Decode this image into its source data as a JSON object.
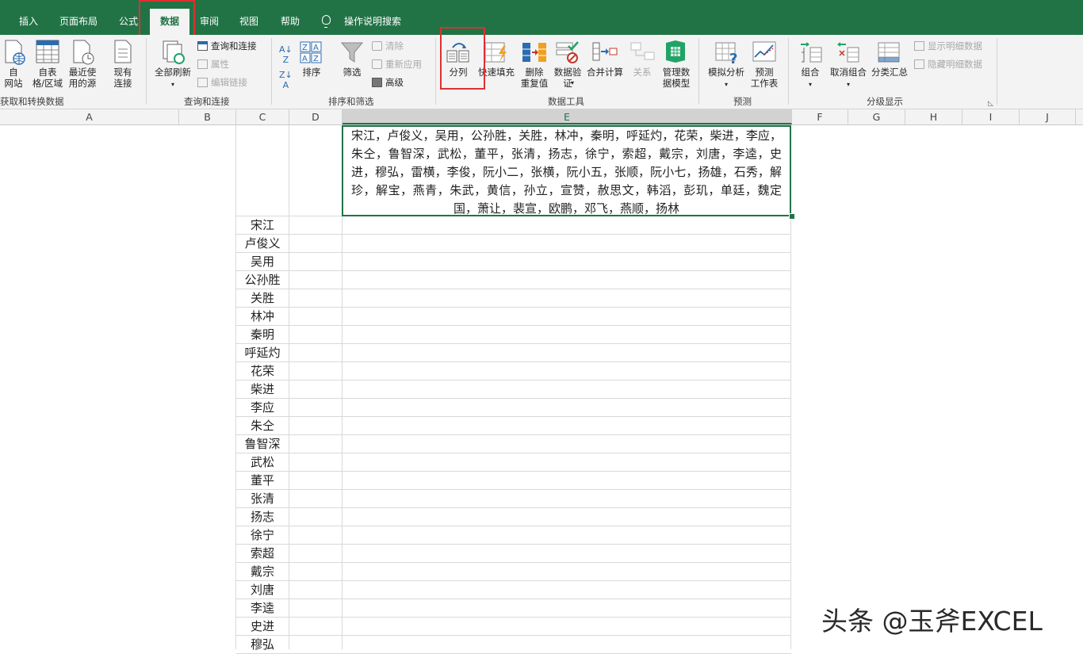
{
  "tabs": [
    "插入",
    "页面布局",
    "公式",
    "数据",
    "审阅",
    "视图",
    "帮助",
    "操作说明搜索"
  ],
  "ribbon": {
    "get_transform": {
      "from_web": "自\n网站",
      "from_table": "自表\n格/区域",
      "recent_sources": "最近使\n用的源",
      "existing": "现有\n连接",
      "group_label": "获取和转换数据"
    },
    "queries": {
      "refresh_all": "全部刷新",
      "queries_connections": "查询和连接",
      "properties": "属性",
      "edit_links": "编辑链接",
      "group_label": "查询和连接"
    },
    "sort_filter": {
      "sort": "排序",
      "filter": "筛选",
      "clear": "清除",
      "reapply": "重新应用",
      "advanced": "高级",
      "group_label": "排序和筛选"
    },
    "data_tools": {
      "text_to_columns": "分列",
      "flash_fill": "快速填充",
      "remove_dup": "删除\n重复值",
      "validation": "数据验\n证",
      "consolidate": "合并计算",
      "relationships": "关系",
      "data_model": "管理数\n据模型",
      "group_label": "数据工具"
    },
    "forecast": {
      "what_if": "模拟分析",
      "forecast_sheet": "预测\n工作表",
      "group_label": "预测"
    },
    "outline": {
      "group": "组合",
      "ungroup": "取消组合",
      "subtotal": "分类汇总",
      "show_detail": "显示明细数据",
      "hide_detail": "隐藏明细数据",
      "group_label": "分级显示"
    }
  },
  "columns": [
    "A",
    "B",
    "C",
    "D",
    "E",
    "F",
    "G",
    "H",
    "I",
    "J"
  ],
  "cell_E1": "宋江，卢俊义，吴用，公孙胜，关胜，林冲，秦明，呼延灼，花荣，柴进，李应，朱仝，鲁智深，武松，董平，张清，扬志，徐宁，索超，戴宗，刘唐，李逵，史进，穆弘，雷横，李俊，阮小二，张横，阮小五，张顺，阮小七，扬雄，石秀，解珍，解宝，燕青，朱武，黄信，孙立，宣赞，赦思文，韩滔，彭玑，单廷，魏定国，萧让，裴宣，欧鹏，邓飞，燕顺，扬林",
  "column_C": [
    "宋江",
    "卢俊义",
    "吴用",
    "公孙胜",
    "关胜",
    "林冲",
    "秦明",
    "呼延灼",
    "花荣",
    "柴进",
    "李应",
    "朱仝",
    "鲁智深",
    "武松",
    "董平",
    "张清",
    "扬志",
    "徐宁",
    "索超",
    "戴宗",
    "刘唐",
    "李逵",
    "史进",
    "穆弘"
  ],
  "watermark": "头条 @玉斧EXCEL",
  "colors": {
    "excel_green": "#217346",
    "highlight_red": "#e03030"
  }
}
